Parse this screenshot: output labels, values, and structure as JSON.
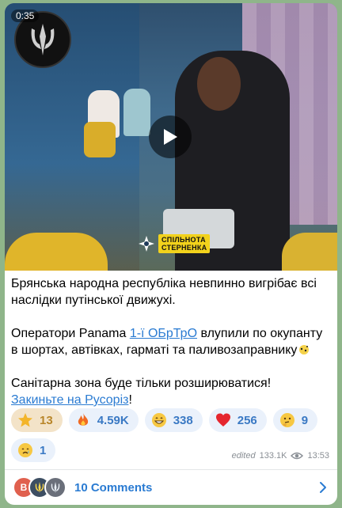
{
  "video": {
    "duration": "0:35",
    "watermark_line1": "СПІЛЬНОТА",
    "watermark_line2": "СТЕРНЕНКА"
  },
  "message": {
    "para1": "Брянська народна республіка невпинно вигрібає всі наслідки путінської движухі.",
    "para2_before": "Оператори Panama ",
    "para2_link": "1-ї ОБрТрО",
    "para2_after": " влупили по окупанту в шортах, автівках, гарматі та паливозаправнику",
    "para3": "Санітарна зона буде тільки розширюватися!",
    "para4_link": "Закиньте на Русоріз",
    "para4_after": "!"
  },
  "reactions": [
    {
      "emoji": "star",
      "count": "13",
      "active": true
    },
    {
      "emoji": "fire",
      "count": "4.59K",
      "active": false
    },
    {
      "emoji": "grin",
      "count": "338",
      "active": false
    },
    {
      "emoji": "heart",
      "count": "256",
      "active": false
    },
    {
      "emoji": "thinking",
      "count": "9",
      "active": false
    },
    {
      "emoji": "cry",
      "count": "1",
      "active": false
    }
  ],
  "meta": {
    "edited": "edited",
    "views": "133.1K",
    "time": "13:53"
  },
  "comments": {
    "avatar_letter": "B",
    "label": "10 Comments"
  },
  "colors": {
    "background": "#8fb58a",
    "link": "#2a7bd2",
    "reaction_bg": "#eaf1fb"
  }
}
